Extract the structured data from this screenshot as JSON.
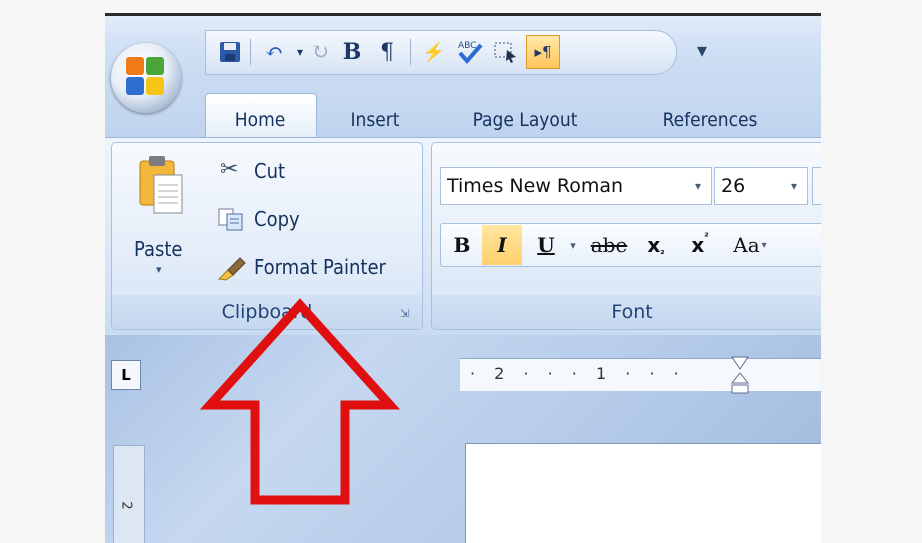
{
  "quick_access": {
    "buttons": [
      "save",
      "undo",
      "redo",
      "bold",
      "pilcrow",
      "spelling",
      "abc-check",
      "select",
      "rtl"
    ],
    "bold_glyph": "B",
    "pilcrow_glyph": "¶"
  },
  "tabs": [
    "Home",
    "Insert",
    "Page Layout",
    "References"
  ],
  "clipboard": {
    "paste_label": "Paste",
    "cut_label": "Cut",
    "copy_label": "Copy",
    "format_painter_label": "Format Painter",
    "group_label": "Clipboard"
  },
  "font": {
    "font_name": "Times New Roman",
    "font_size": "26",
    "group_label": "Font",
    "buttons": {
      "bold": "B",
      "italic": "I",
      "underline": "U",
      "strikethrough": "abe",
      "subscript": "x",
      "superscript": "x",
      "change_case": "Aa"
    }
  },
  "ruler": {
    "corner_glyph": "L",
    "ticks": "· 2 · · · 1 · · ·",
    "vertical_number": "2"
  },
  "colors": {
    "arrow": "#e01010",
    "highlight": "#ffd27a"
  }
}
